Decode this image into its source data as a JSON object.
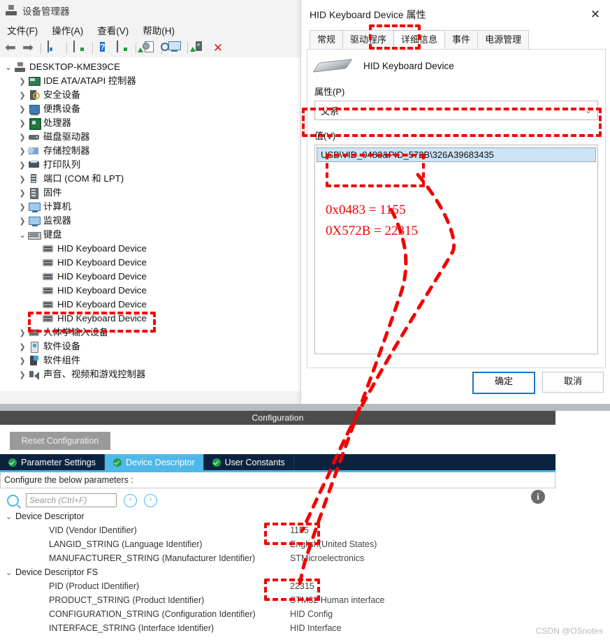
{
  "device_manager": {
    "title": "设备管理器",
    "menu": [
      "文件(F)",
      "操作(A)",
      "查看(V)",
      "帮助(H)"
    ],
    "toolbar_icons": [
      "back-arrow-icon",
      "forward-arrow-icon",
      "show-hide-console-tree-icon",
      "properties-icon",
      "help-icon",
      "show-hide-action-pane-icon",
      "update-driver-icon",
      "scan-hardware-changes-icon",
      "enable-device-icon",
      "uninstall-device-icon"
    ],
    "tree": [
      {
        "label": "DESKTOP-KME39CE",
        "depth": 0,
        "state": "expanded",
        "icon": "computer-icon"
      },
      {
        "label": "IDE ATA/ATAPI 控制器",
        "depth": 1,
        "state": "collapsed",
        "icon": "ide-controller-icon"
      },
      {
        "label": "安全设备",
        "depth": 1,
        "state": "collapsed",
        "icon": "security-device-icon"
      },
      {
        "label": "便携设备",
        "depth": 1,
        "state": "collapsed",
        "icon": "portable-device-icon"
      },
      {
        "label": "处理器",
        "depth": 1,
        "state": "collapsed",
        "icon": "processor-icon"
      },
      {
        "label": "磁盘驱动器",
        "depth": 1,
        "state": "collapsed",
        "icon": "disk-drive-icon"
      },
      {
        "label": "存储控制器",
        "depth": 1,
        "state": "collapsed",
        "icon": "storage-controller-icon"
      },
      {
        "label": "打印队列",
        "depth": 1,
        "state": "collapsed",
        "icon": "print-queue-icon"
      },
      {
        "label": "端口 (COM 和 LPT)",
        "depth": 1,
        "state": "collapsed",
        "icon": "com-port-icon"
      },
      {
        "label": "固件",
        "depth": 1,
        "state": "collapsed",
        "icon": "firmware-icon"
      },
      {
        "label": "计算机",
        "depth": 1,
        "state": "collapsed",
        "icon": "monitor-icon"
      },
      {
        "label": "监视器",
        "depth": 1,
        "state": "collapsed",
        "icon": "monitor-icon"
      },
      {
        "label": "键盘",
        "depth": 1,
        "state": "expanded",
        "icon": "keyboard-icon"
      },
      {
        "label": "HID Keyboard Device",
        "depth": 2,
        "state": "leaf",
        "icon": "hid-keyboard-icon"
      },
      {
        "label": "HID Keyboard Device",
        "depth": 2,
        "state": "leaf",
        "icon": "hid-keyboard-icon"
      },
      {
        "label": "HID Keyboard Device",
        "depth": 2,
        "state": "leaf",
        "icon": "hid-keyboard-icon"
      },
      {
        "label": "HID Keyboard Device",
        "depth": 2,
        "state": "leaf",
        "icon": "hid-keyboard-icon"
      },
      {
        "label": "HID Keyboard Device",
        "depth": 2,
        "state": "leaf",
        "icon": "hid-keyboard-icon"
      },
      {
        "label": "HID Keyboard Device",
        "depth": 2,
        "state": "leaf",
        "icon": "hid-keyboard-icon"
      },
      {
        "label": "人体学输入设备",
        "depth": 1,
        "state": "collapsed",
        "icon": "hid-device-icon"
      },
      {
        "label": "软件设备",
        "depth": 1,
        "state": "collapsed",
        "icon": "software-device-icon"
      },
      {
        "label": "软件组件",
        "depth": 1,
        "state": "collapsed",
        "icon": "software-component-icon"
      },
      {
        "label": "声音、视频和游戏控制器",
        "depth": 1,
        "state": "collapsed",
        "icon": "sound-controller-icon"
      }
    ]
  },
  "dialog": {
    "title": "HID Keyboard Device 属性",
    "close_label": "✕",
    "tabs": [
      {
        "label": "常规",
        "active": false
      },
      {
        "label": "驱动程序",
        "active": false
      },
      {
        "label": "详细信息",
        "active": true
      },
      {
        "label": "事件",
        "active": false
      },
      {
        "label": "电源管理",
        "active": false
      }
    ],
    "device_name": "HID Keyboard Device",
    "property_label": "属性(P)",
    "property_selected": "父系",
    "value_label": "值(V)",
    "value_selected": "USB\\VID_0483&PID_572B\\326A39683435",
    "buttons": {
      "ok": "确定",
      "cancel": "取消"
    }
  },
  "cubemx": {
    "header": "Configuration",
    "reset_button": "Reset Configuration",
    "tabs": [
      {
        "label": "Parameter Settings",
        "active": false
      },
      {
        "label": "Device Descriptor",
        "active": true
      },
      {
        "label": "User Constants",
        "active": false
      }
    ],
    "note": "Configure the below parameters :",
    "search_placeholder": "Search (Ctrl+F)",
    "prev_label": "‹",
    "next_label": "›",
    "info_label": "i",
    "groups": [
      {
        "name": "Device Descriptor",
        "rows": [
          {
            "name": "VID (Vendor IDentifier)",
            "value": "1155"
          },
          {
            "name": "LANGID_STRING (Language Identifier)",
            "value": "English(United States)"
          },
          {
            "name": "MANUFACTURER_STRING (Manufacturer Identifier)",
            "value": "STMicroelectronics"
          }
        ]
      },
      {
        "name": "Device Descriptor FS",
        "rows": [
          {
            "name": "PID (Product IDentifier)",
            "value": "22315"
          },
          {
            "name": "PRODUCT_STRING (Product Identifier)",
            "value": "STM32 Human interface"
          },
          {
            "name": "CONFIGURATION_STRING (Configuration Identifier)",
            "value": "HID Config"
          },
          {
            "name": "INTERFACE_STRING (Interface Identifier)",
            "value": "HID Interface"
          }
        ]
      }
    ]
  },
  "annotations": {
    "color": "#f20000",
    "vid_note": "0x0483 = 1155",
    "pid_note": "0X572B = 22315"
  },
  "watermark": "CSDN @OSnotes"
}
